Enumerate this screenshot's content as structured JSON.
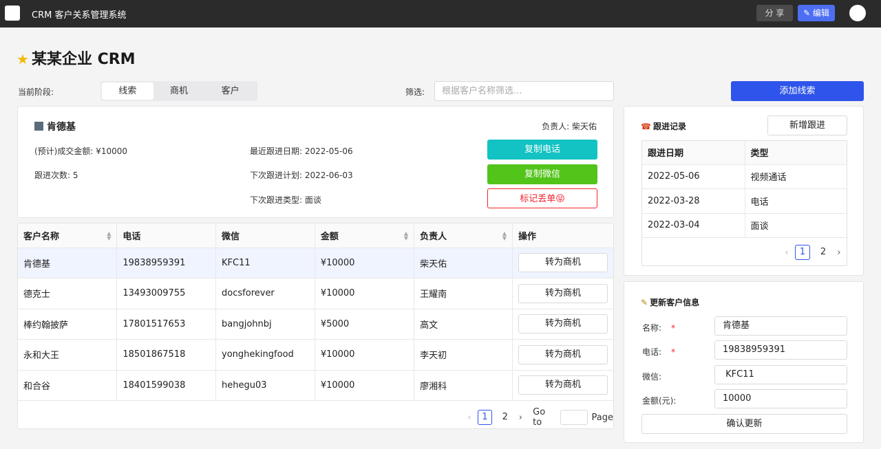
{
  "topbar": {
    "app_title": "CRM 客户关系管理系统",
    "share_label": "分 享",
    "edit_label": "✎ 编辑",
    "logo_icon": "app-logo-icon",
    "avatar_icon": "user-avatar-icon"
  },
  "page": {
    "title": "某某企业 CRM",
    "title_icon": "★"
  },
  "stage": {
    "label": "当前阶段:",
    "options": [
      "线索",
      "商机",
      "客户"
    ],
    "selected": "线索"
  },
  "filter": {
    "label": "筛选:",
    "placeholder": "根据客户名称筛选...",
    "value": ""
  },
  "add_lead_label": "添加线索",
  "detail": {
    "name": "肯德基",
    "owner": "负责人: 柴天佑",
    "deal_amount": "(预计)成交金额: ¥10000",
    "follow_count": "跟进次数: 5",
    "last_follow": "最近跟进日期: 2022-05-06",
    "next_plan": "下次跟进计划: 2022-06-03",
    "next_type": "下次跟进类型: 面谈",
    "copy_phone_label": "复制电话",
    "copy_wechat_label": "复制微信",
    "mark_lost_label": "标记丢单😝"
  },
  "customer_table": {
    "headers": [
      "客户名称",
      "电话",
      "微信",
      "金额",
      "负责人",
      "操作"
    ],
    "rows": [
      {
        "name": "肯德基",
        "phone": "19838959391",
        "wechat": "KFC11",
        "amount": "¥10000",
        "owner": "柴天佑",
        "action": "转为商机"
      },
      {
        "name": "德克士",
        "phone": "13493009755",
        "wechat": "docsforever",
        "amount": "¥10000",
        "owner": "王耀南",
        "action": "转为商机"
      },
      {
        "name": "棒约翰披萨",
        "phone": "17801517653",
        "wechat": "bangjohnbj",
        "amount": "¥5000",
        "owner": "高文",
        "action": "转为商机"
      },
      {
        "name": "永和大王",
        "phone": "18501867518",
        "wechat": "yonghekingfood",
        "amount": "¥10000",
        "owner": "李天初",
        "action": "转为商机"
      },
      {
        "name": "和合谷",
        "phone": "18401599038",
        "wechat": "hehegu03",
        "amount": "¥10000",
        "owner": "廖湘科",
        "action": "转为商机"
      }
    ],
    "pagination": {
      "pages": [
        "1",
        "2"
      ],
      "current": "1",
      "goto_label": "Go to",
      "page_label": "Page"
    }
  },
  "follow_records": {
    "title": "跟进记录",
    "new_label": "新增跟进",
    "headers": [
      "跟进日期",
      "类型"
    ],
    "rows": [
      {
        "date": "2022-05-06",
        "type": "视频通话"
      },
      {
        "date": "2022-03-28",
        "type": "电话"
      },
      {
        "date": "2022-03-04",
        "type": "面谈"
      }
    ],
    "pagination": {
      "pages": [
        "1",
        "2"
      ],
      "current": "1"
    }
  },
  "update_form": {
    "title": "更新客户信息",
    "fields": [
      {
        "label": "名称:",
        "required": true,
        "value": "肯德基"
      },
      {
        "label": "电话:",
        "required": true,
        "value": "19838959391"
      },
      {
        "label": "微信:",
        "required": false,
        "value": " KFC11"
      },
      {
        "label": "金额(元):",
        "required": false,
        "value": "10000"
      }
    ],
    "confirm_label": "确认更新"
  },
  "colors": {
    "accent": "#2f54eb",
    "phone_btn": "#13c2c2",
    "wechat_btn": "#52c41a",
    "danger": "#f5222d"
  }
}
